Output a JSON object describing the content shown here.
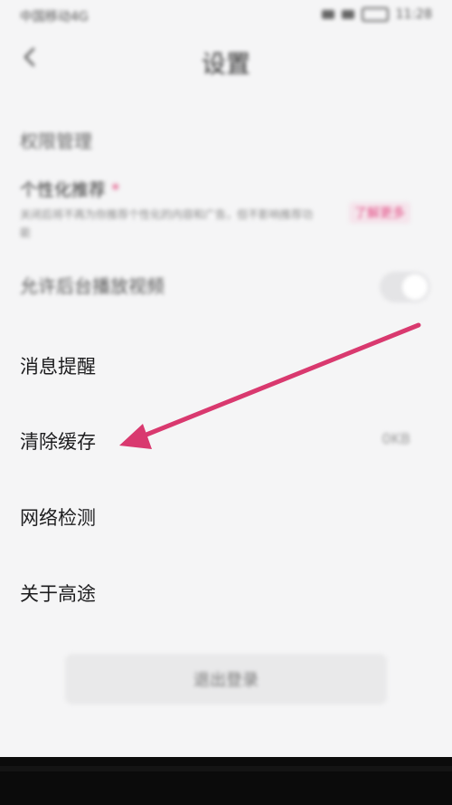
{
  "status_bar": {
    "left_text": "中国移动4G",
    "right_text": "11:28"
  },
  "header": {
    "title": "设置"
  },
  "sections": {
    "permission_title": "权限管理",
    "recommend": {
      "title": "个性化推荐",
      "description": "关闭后将不再为你推荐个性化的内容和广告，但不影响推荐功能",
      "link_label": "了解更多"
    },
    "background_play": {
      "label": "允许后台播放视频"
    }
  },
  "menu": {
    "items": [
      {
        "label": "消息提醒"
      },
      {
        "label": "清除缓存",
        "value": "0KB"
      },
      {
        "label": "网络检测"
      },
      {
        "label": "关于高途"
      }
    ]
  },
  "footer": {
    "logout_label": "退出登录"
  },
  "colors": {
    "accent": "#d9396f",
    "background": "#f5f5f6"
  }
}
